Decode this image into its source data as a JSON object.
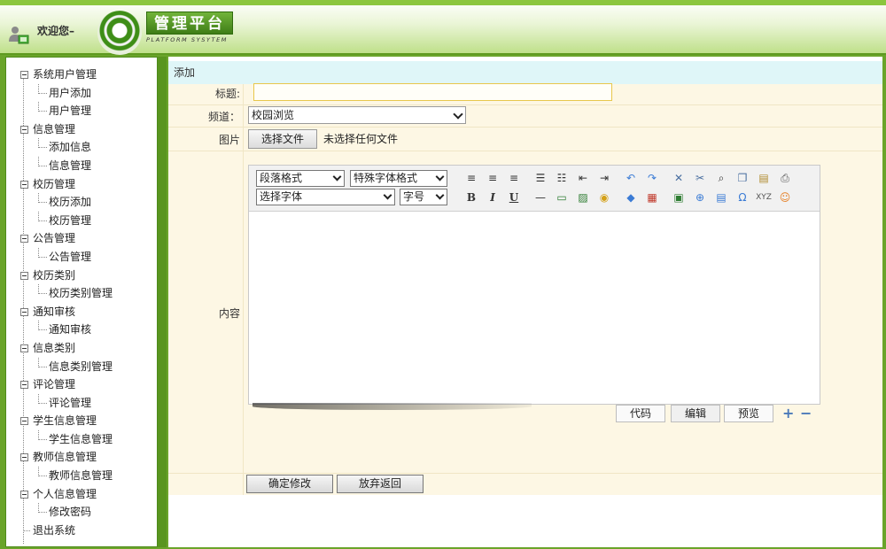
{
  "header": {
    "welcome": "欢迎您–",
    "logo_title": "管理平台",
    "logo_subtitle": "PLATFORM SYSYTEM"
  },
  "sidebar": {
    "groups": [
      {
        "label": "系统用户管理",
        "children": [
          "用户添加",
          "用户管理"
        ]
      },
      {
        "label": "信息管理",
        "children": [
          "添加信息",
          "信息管理"
        ]
      },
      {
        "label": "校历管理",
        "children": [
          "校历添加",
          "校历管理"
        ]
      },
      {
        "label": "公告管理",
        "children": [
          "公告管理"
        ]
      },
      {
        "label": "校历类别",
        "children": [
          "校历类别管理"
        ]
      },
      {
        "label": "通知审核",
        "children": [
          "通知审核"
        ]
      },
      {
        "label": "信息类别",
        "children": [
          "信息类别管理"
        ]
      },
      {
        "label": "评论管理",
        "children": [
          "评论管理"
        ]
      },
      {
        "label": "学生信息管理",
        "children": [
          "学生信息管理"
        ]
      },
      {
        "label": "教师信息管理",
        "children": [
          "教师信息管理"
        ]
      },
      {
        "label": "个人信息管理",
        "children": [
          "修改密码"
        ]
      },
      {
        "label": "退出系统",
        "children": []
      }
    ]
  },
  "main": {
    "section_title": "添加",
    "form": {
      "title_label": "标题:",
      "title_value": "",
      "channel_label": "频道：",
      "channel_value": "校园浏览",
      "image_label": "图片",
      "file_button": "选择文件",
      "file_status": "未选择任何文件",
      "content_label": "内容"
    },
    "editor": {
      "paragraph_select": "段落格式",
      "special_font_select": "特殊字体格式",
      "font_select": "选择字体",
      "size_select": "字号",
      "bold": "B",
      "italic": "I",
      "underline": "U",
      "mode_code": "代码",
      "mode_edit": "编辑",
      "mode_preview": "预览"
    },
    "buttons": {
      "confirm": "确定修改",
      "cancel": "放弃返回"
    }
  }
}
